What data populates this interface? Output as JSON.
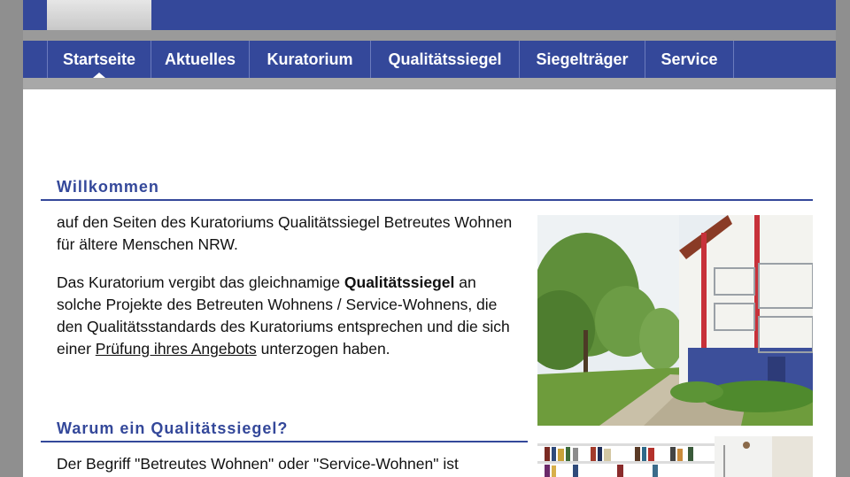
{
  "nav": {
    "items": [
      {
        "label": "Startseite"
      },
      {
        "label": "Aktuelles"
      },
      {
        "label": "Kuratorium"
      },
      {
        "label": "Qualitätssiegel"
      },
      {
        "label": "Siegelträger"
      },
      {
        "label": "Service"
      }
    ],
    "active": "Startseite"
  },
  "welcome": {
    "heading": "Willkommen",
    "intro": "auf den Seiten des Kuratoriums Qualitätssiegel Betreutes Wohnen für ältere Menschen NRW.",
    "para_before": "Das Kuratorium vergibt das gleichnamige ",
    "para_bold": "Qualitätssiegel",
    "para_middle": " an solche Projekte des Betreuten Wohnens / Service-Wohnens, die den Qualitätsstandards des Kuratoriums entsprechen und die sich einer ",
    "para_link": "Prüfung ihres Angebots",
    "para_after": " unterzogen haben."
  },
  "why": {
    "heading": "Warum ein Qualitätssiegel?",
    "text": "Der Begriff \"Betreutes Wohnen\" oder \"Service-Wohnen\" ist"
  },
  "colors": {
    "brand": "#34489a",
    "background": "#ffffff"
  }
}
